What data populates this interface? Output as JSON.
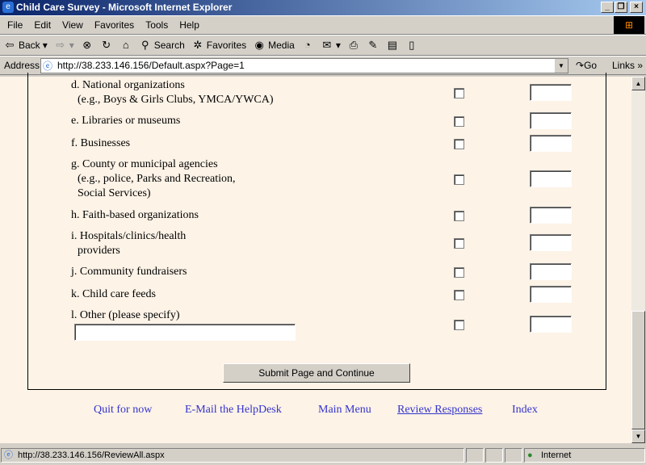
{
  "window": {
    "title": "Child Care Survey - Microsoft Internet Explorer"
  },
  "menu": [
    "File",
    "Edit",
    "View",
    "Favorites",
    "Tools",
    "Help"
  ],
  "toolbar": {
    "back": "Back",
    "search": "Search",
    "favorites": "Favorites",
    "media": "Media"
  },
  "address": {
    "label": "Address",
    "url": "http://38.233.146.156/Default.aspx?Page=1",
    "go": "Go",
    "links": "Links"
  },
  "rows": [
    {
      "l1": "d. National organizations",
      "l2": "(e.g., Boys & Girls Clubs, YMCA/YWCA)"
    },
    {
      "l1": "e. Libraries or museums"
    },
    {
      "l1": "f. Businesses"
    },
    {
      "l1": "g. County or municipal agencies",
      "l2": "(e.g., police, Parks and Recreation,",
      "l3": "Social Services)"
    },
    {
      "l1": "h. Faith-based organizations"
    },
    {
      "l1": "i. Hospitals/clinics/health",
      "l2": "providers"
    },
    {
      "l1": "j. Community fundraisers"
    },
    {
      "l1": "k. Child care feeds"
    },
    {
      "l1": "l. Other (please specify)"
    }
  ],
  "submit": "Submit Page and Continue",
  "links": [
    "Quit for now",
    "E-Mail the HelpDesk",
    "Main Menu",
    "Review Responses",
    "Index"
  ],
  "status": {
    "url": "http://38.233.146.156/ReviewAll.aspx",
    "zone": "Internet"
  }
}
